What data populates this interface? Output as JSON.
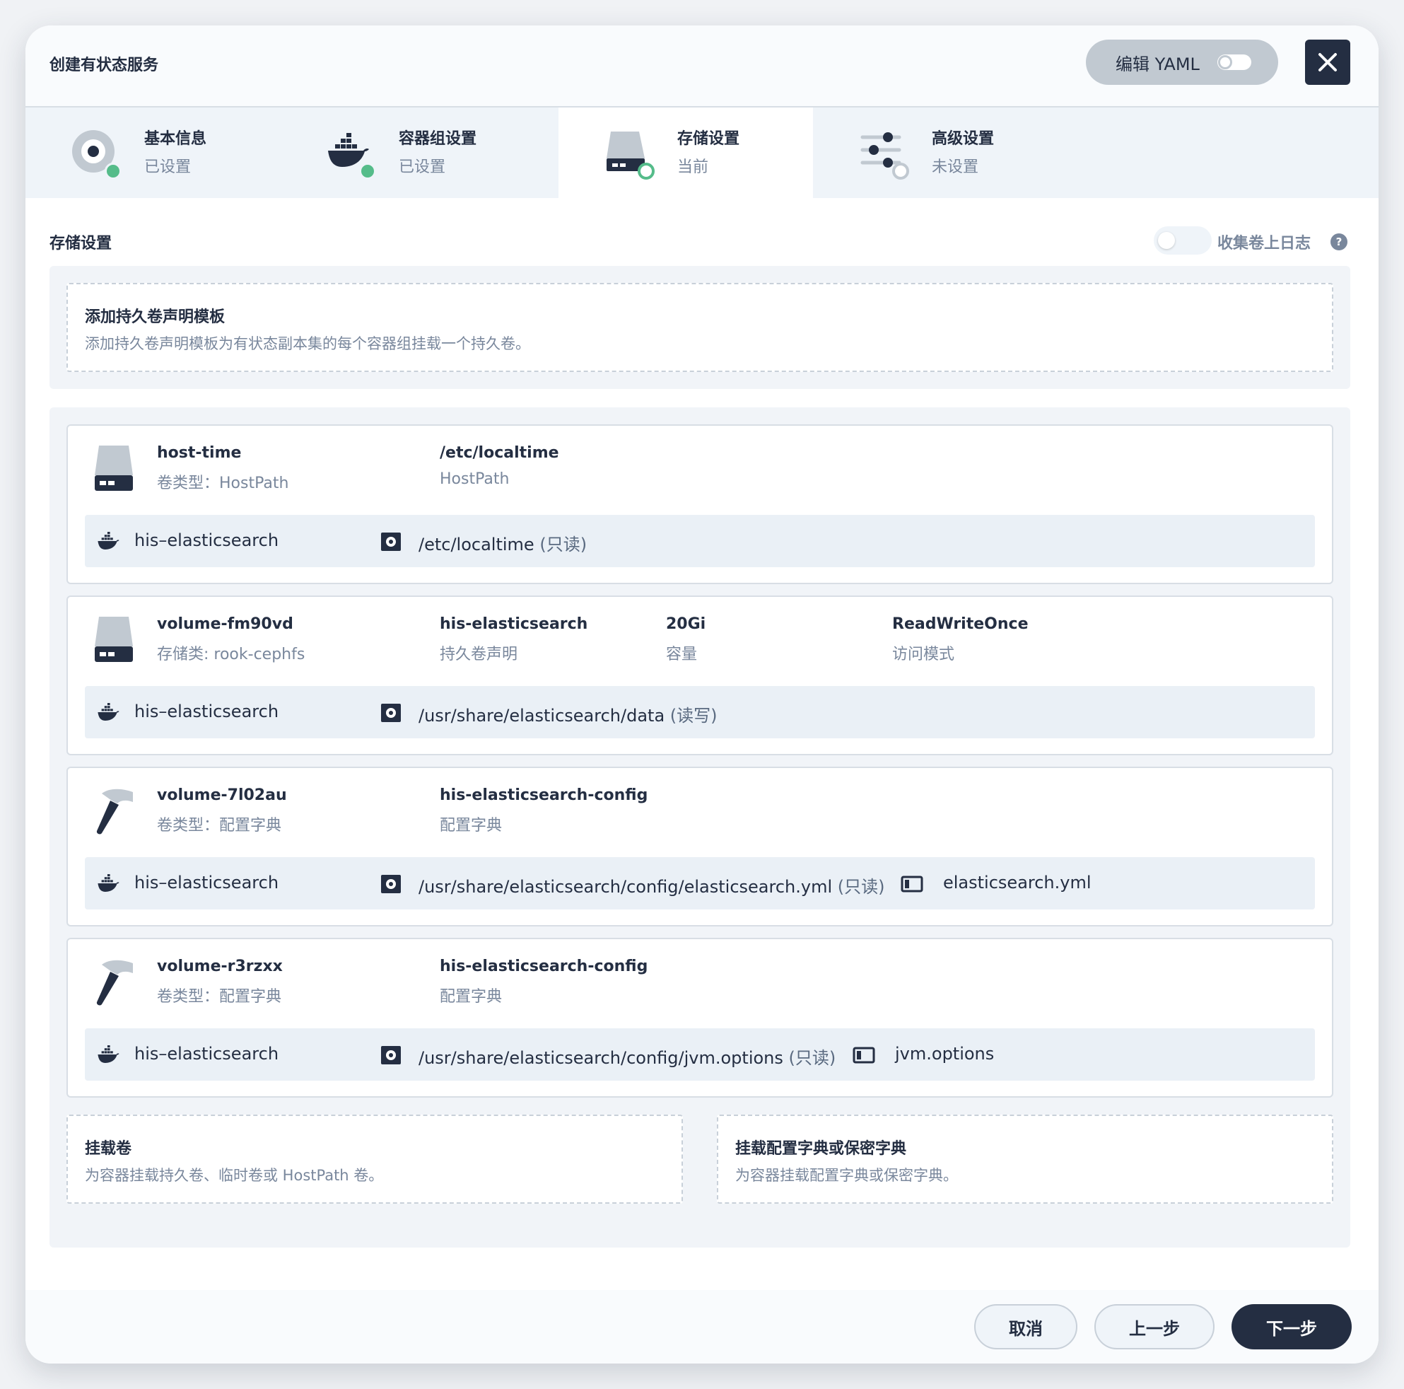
{
  "header": {
    "title": "创建有状态服务",
    "yaml_label": "编辑 YAML",
    "close_icon": "close-icon"
  },
  "steps": [
    {
      "title": "基本信息",
      "status": "已设置",
      "icon": "disc-icon",
      "state": "done"
    },
    {
      "title": "容器组设置",
      "status": "已设置",
      "icon": "docker-icon",
      "state": "done"
    },
    {
      "title": "存储设置",
      "status": "当前",
      "icon": "storage-icon",
      "state": "current"
    },
    {
      "title": "高级设置",
      "status": "未设置",
      "icon": "sliders-icon",
      "state": "todo"
    }
  ],
  "storage": {
    "title": "存储设置",
    "collect_logs_label": "收集卷上日志",
    "collect_logs_enabled": false,
    "help": "?"
  },
  "pvc_template": {
    "title": "添加持久卷声明模板",
    "desc": "添加持久卷声明模板为有状态副本集的每个容器组挂载一个持久卷。"
  },
  "volumes": [
    {
      "name": "host-time",
      "sub": "卷类型：HostPath",
      "icon": "disk-icon",
      "cols": [
        {
          "v": "/etc/localtime",
          "l": "HostPath"
        }
      ],
      "mount": {
        "container": "his–elasticsearch",
        "path": "/etc/localtime",
        "mode": "(只读)",
        "file": ""
      }
    },
    {
      "name": "volume-fm90vd",
      "sub": "存储类: rook-cephfs",
      "icon": "disk-icon",
      "cols": [
        {
          "v": "his-elasticsearch",
          "l": "持久卷声明"
        },
        {
          "v": "20Gi",
          "l": "容量"
        },
        {
          "v": "ReadWriteOnce",
          "l": "访问模式"
        }
      ],
      "mount": {
        "container": "his–elasticsearch",
        "path": "/usr/share/elasticsearch/data",
        "mode": "(读写)",
        "file": ""
      }
    },
    {
      "name": "volume-7l02au",
      "sub": "卷类型：配置字典",
      "icon": "hammer-icon",
      "cols": [
        {
          "v": "his-elasticsearch-config",
          "l": "配置字典"
        }
      ],
      "mount": {
        "container": "his–elasticsearch",
        "path": "/usr/share/elasticsearch/config/elasticsearch.yml",
        "mode": "(只读)",
        "file": "elasticsearch.yml"
      }
    },
    {
      "name": "volume-r3rzxx",
      "sub": "卷类型：配置字典",
      "icon": "hammer-icon",
      "cols": [
        {
          "v": "his-elasticsearch-config",
          "l": "配置字典"
        }
      ],
      "mount": {
        "container": "his–elasticsearch",
        "path": "/usr/share/elasticsearch/config/jvm.options",
        "mode": "(只读)",
        "file": "jvm.options"
      }
    }
  ],
  "mount_volume": {
    "title": "挂载卷",
    "desc": "为容器挂载持久卷、临时卷或 HostPath 卷。"
  },
  "mount_config": {
    "title": "挂载配置字典或保密字典",
    "desc": "为容器挂载配置字典或保密字典。"
  },
  "footer": {
    "cancel": "取消",
    "prev": "上一步",
    "next": "下一步"
  }
}
